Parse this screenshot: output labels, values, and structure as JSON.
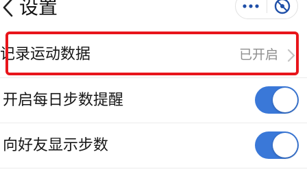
{
  "header": {
    "title": "设置",
    "back_icon": "chevron-left-icon",
    "more_icon": "more-dots-icon",
    "close_icon": "close-target-icon"
  },
  "settings": [
    {
      "label": "记录运动数据",
      "value": "已开启",
      "control": "chevron-right-icon"
    },
    {
      "label": "开启每日步数提醒",
      "toggle_on": true
    },
    {
      "label": "向好友显示步数",
      "toggle_on": true
    }
  ],
  "colors": {
    "accent": "#3a78d8",
    "highlight": "#e8151b",
    "secondary_text": "#8e8e8e"
  }
}
